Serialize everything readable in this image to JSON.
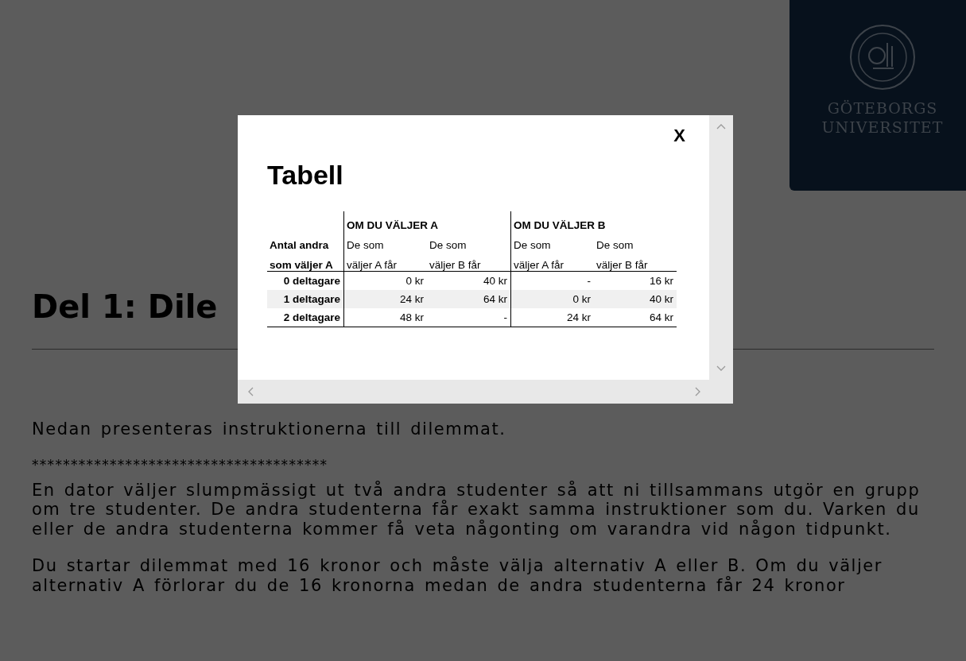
{
  "page": {
    "logo": {
      "lines": [
        "GÖTEBORGS",
        "UNIVERSITET"
      ]
    },
    "heading": "Del 1: Dile",
    "intro": "Nedan presenteras instruktionerna till dilemmat.",
    "separator": "**************************************",
    "paragraphs": [
      "En dator väljer slumpmässigt ut två andra studenter så att ni tillsammans utgör en grupp om tre studenter. De andra studenterna får exakt samma instruktioner som du. Varken du eller de andra studenterna kommer få veta någonting om varandra vid någon tidpunkt.",
      "Du startar dilemmat med 16 kronor och måste välja alternativ A eller B. Om du väljer alternativ A förlorar du de 16 kronorna medan de andra studenterna får 24 kronor"
    ]
  },
  "modal": {
    "close": "X",
    "title": "Tabell",
    "table": {
      "groups": [
        "OM DU VÄLJER A",
        "OM DU VÄLJER B"
      ],
      "header_rows": [
        {
          "label": "Antal andra",
          "cells": [
            "De som",
            "De som",
            "De som",
            "De som"
          ]
        },
        {
          "label": "som väljer A",
          "cells": [
            "väljer A får",
            "väljer B får",
            "väljer A får",
            "väljer B får"
          ]
        }
      ],
      "rows": [
        {
          "label": "0 deltagare",
          "shaded": false,
          "cells": [
            "0 kr",
            "40 kr",
            "-",
            "16 kr"
          ]
        },
        {
          "label": "1 deltagare",
          "shaded": true,
          "cells": [
            "24 kr",
            "64 kr",
            "0 kr",
            "40 kr"
          ]
        },
        {
          "label": "2 deltagare",
          "shaded": false,
          "cells": [
            "48 kr",
            "-",
            "24 kr",
            "64 kr"
          ]
        }
      ]
    }
  }
}
